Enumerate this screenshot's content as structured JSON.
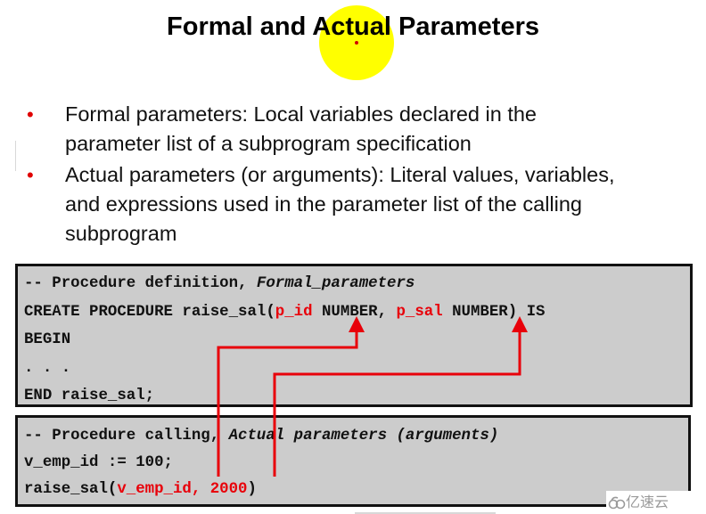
{
  "slide": {
    "title": "Formal and Actual Parameters",
    "bullets": [
      {
        "line1": "Formal parameters: Local variables declared in the",
        "line2": "parameter list of a subprogram specification"
      },
      {
        "line1": "Actual parameters (or arguments): Literal values, variables,",
        "line2": "and expressions used in the parameter list of the calling",
        "line3": "subprogram"
      }
    ],
    "bullet_glyph": "•"
  },
  "definition_code": {
    "comment_prefix": "-- Procedure definition, ",
    "comment_italic": "Formal_parameters",
    "create_prefix": "CREATE PROCEDURE raise_sal(",
    "param1": "p_id",
    "type1": " NUMBER, ",
    "param2": "p_sal",
    "create_suffix": " NUMBER) IS",
    "begin": "BEGIN",
    "ellipsis": ". . .",
    "end": "END raise_sal;"
  },
  "calling_code": {
    "comment_prefix": "-- Procedure calling, ",
    "comment_italic": "Actual parameters (arguments)",
    "assign": "v_emp_id := 100;",
    "call_prefix": "raise_sal(",
    "call_args": "v_emp_id, 2000",
    "call_suffix": ")"
  },
  "arrows": [
    {
      "from": "v_emp_id",
      "to": "p_id"
    },
    {
      "from": "2000",
      "to": "p_sal"
    }
  ],
  "colors": {
    "highlight": "#ffff00",
    "accent_red": "#e8000a",
    "code_bg": "#cccccc"
  },
  "watermark": {
    "text": "亿速云",
    "icon": "cloud-logo-icon"
  }
}
